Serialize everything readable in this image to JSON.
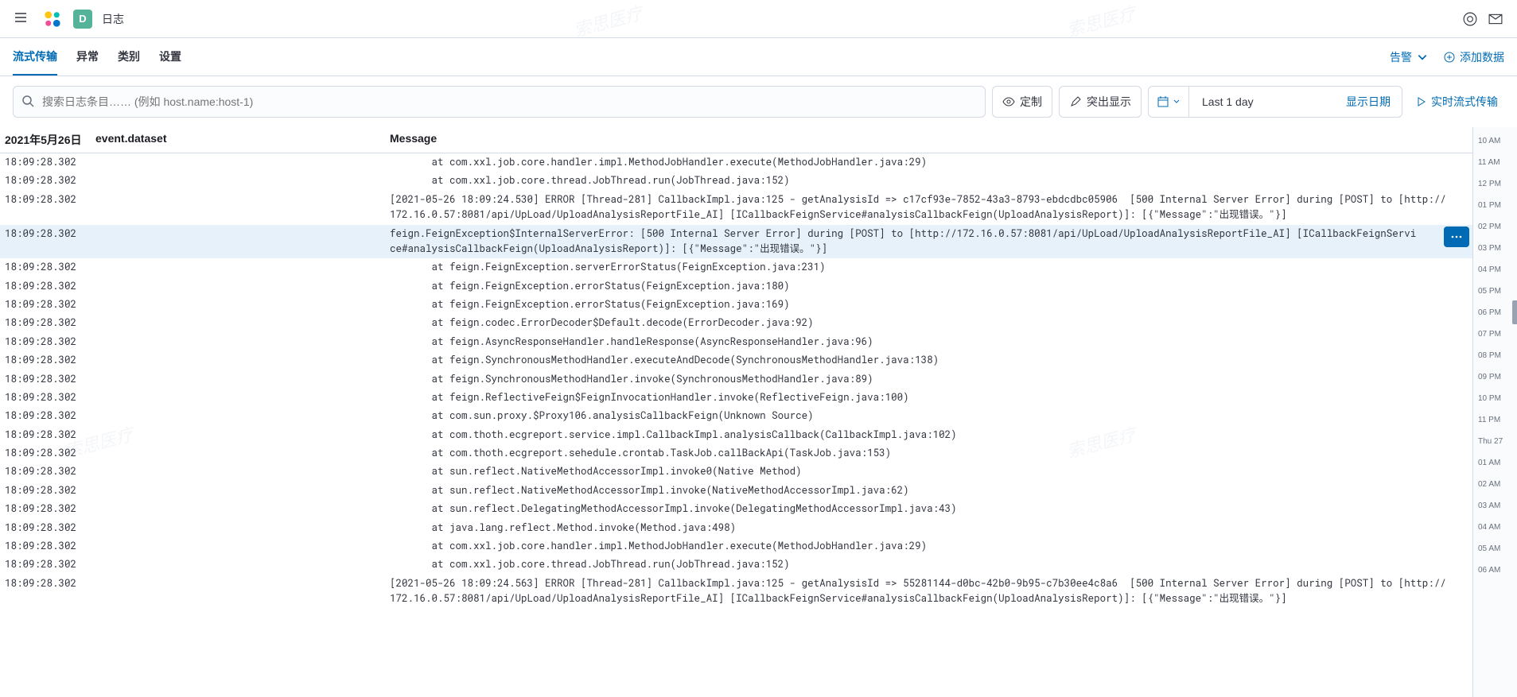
{
  "header": {
    "space_letter": "D",
    "breadcrumb": "日志"
  },
  "tabs": [
    {
      "label": "流式传输",
      "active": true
    },
    {
      "label": "异常",
      "active": false
    },
    {
      "label": "类别",
      "active": false
    },
    {
      "label": "设置",
      "active": false
    }
  ],
  "tabs_right": {
    "alerts": "告警",
    "add_data": "添加数据"
  },
  "toolbar": {
    "search_placeholder": "搜索日志条目…… (例如 host.name:host-1)",
    "customize": "定制",
    "highlight": "突出显示",
    "date_range": "Last 1 day",
    "show_dates": "显示日期",
    "stream_live": "实时流式传输"
  },
  "columns": {
    "time": "2021年5月26日",
    "dataset": "event.dataset",
    "message": "Message"
  },
  "default_ts": "18:09:28.302",
  "rows": [
    {
      "msg": "       at com.xxl.job.core.handler.impl.MethodJobHandler.execute(MethodJobHandler.java:29)"
    },
    {
      "msg": "       at com.xxl.job.core.thread.JobThread.run(JobThread.java:152)"
    },
    {
      "msg": "[2021-05-26 18:09:24.530] ERROR [Thread-281] CallbackImpl.java:125 - getAnalysisId => c17cf93e-7852-43a3-8793-ebdcdbc05906  [500 Internal Server Error] during [POST] to [http://172.16.0.57:8081/api/UpLoad/UploadAnalysisReportFile_AI] [ICallbackFeignService#analysisCallbackFeign(UploadAnalysisReport)]: [{\"Message\":\"出现错误。\"}]"
    },
    {
      "msg": "feign.FeignException$InternalServerError: [500 Internal Server Error] during [POST] to [http://172.16.0.57:8081/api/UpLoad/UploadAnalysisReportFile_AI] [ICallbackFeignService#analysisCallbackFeign(UploadAnalysisReport)]: [{\"Message\":\"出现错误。\"}]",
      "highlighted": true
    },
    {
      "msg": "       at feign.FeignException.serverErrorStatus(FeignException.java:231)"
    },
    {
      "msg": "       at feign.FeignException.errorStatus(FeignException.java:180)"
    },
    {
      "msg": "       at feign.FeignException.errorStatus(FeignException.java:169)"
    },
    {
      "msg": "       at feign.codec.ErrorDecoder$Default.decode(ErrorDecoder.java:92)"
    },
    {
      "msg": "       at feign.AsyncResponseHandler.handleResponse(AsyncResponseHandler.java:96)"
    },
    {
      "msg": "       at feign.SynchronousMethodHandler.executeAndDecode(SynchronousMethodHandler.java:138)"
    },
    {
      "msg": "       at feign.SynchronousMethodHandler.invoke(SynchronousMethodHandler.java:89)"
    },
    {
      "msg": "       at feign.ReflectiveFeign$FeignInvocationHandler.invoke(ReflectiveFeign.java:100)"
    },
    {
      "msg": "       at com.sun.proxy.$Proxy106.analysisCallbackFeign(Unknown Source)"
    },
    {
      "msg": "       at com.thoth.ecgreport.service.impl.CallbackImpl.analysisCallback(CallbackImpl.java:102)"
    },
    {
      "msg": "       at com.thoth.ecgreport.sehedule.crontab.TaskJob.callBackApi(TaskJob.java:153)"
    },
    {
      "msg": "       at sun.reflect.NativeMethodAccessorImpl.invoke0(Native Method)"
    },
    {
      "msg": "       at sun.reflect.NativeMethodAccessorImpl.invoke(NativeMethodAccessorImpl.java:62)"
    },
    {
      "msg": "       at sun.reflect.DelegatingMethodAccessorImpl.invoke(DelegatingMethodAccessorImpl.java:43)"
    },
    {
      "msg": "       at java.lang.reflect.Method.invoke(Method.java:498)"
    },
    {
      "msg": "       at com.xxl.job.core.handler.impl.MethodJobHandler.execute(MethodJobHandler.java:29)"
    },
    {
      "msg": "       at com.xxl.job.core.thread.JobThread.run(JobThread.java:152)"
    },
    {
      "msg": "[2021-05-26 18:09:24.563] ERROR [Thread-281] CallbackImpl.java:125 - getAnalysisId => 55281144-d0bc-42b0-9b95-c7b30ee4c8a6  [500 Internal Server Error] during [POST] to [http://172.16.0.57:8081/api/UpLoad/UploadAnalysisReportFile_AI] [ICallbackFeignService#analysisCallbackFeign(UploadAnalysisReport)]: [{\"Message\":\"出现错误。\"}]"
    }
  ],
  "timeline": [
    "10 AM",
    "11 AM",
    "12 PM",
    "01 PM",
    "02 PM",
    "03 PM",
    "04 PM",
    "05 PM",
    "06 PM",
    "07 PM",
    "08 PM",
    "09 PM",
    "10 PM",
    "11 PM",
    "Thu 27",
    "01 AM",
    "02 AM",
    "03 AM",
    "04 AM",
    "05 AM",
    "06 AM"
  ],
  "timeline_current_index": 8,
  "watermarks": [
    "索思医疗",
    "索思医疗",
    "索思医疗",
    "索思医疗"
  ]
}
